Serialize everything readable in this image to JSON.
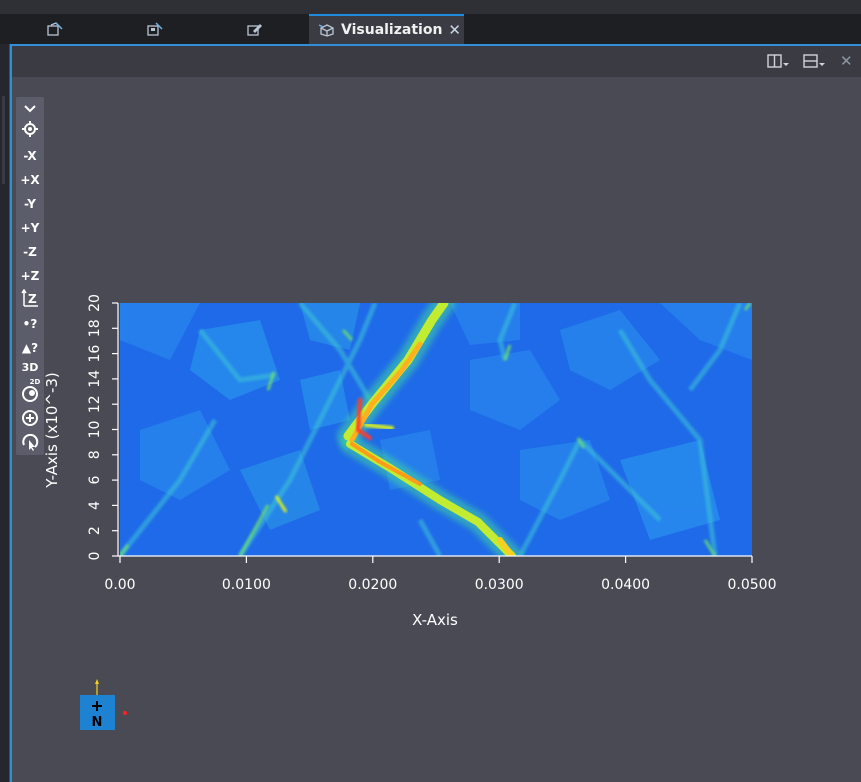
{
  "tabs": [
    {
      "icon": "edit-model-icon"
    },
    {
      "icon": "edit-properties-icon"
    },
    {
      "icon": "edit-pencil-icon"
    },
    {
      "icon": "cube-icon",
      "label": "Visualization",
      "close": "✕",
      "active": true
    }
  ],
  "panel_header": {
    "split_vertical_icon": "split-vertical-icon",
    "split_horizontal_icon": "split-horizontal-icon",
    "close_icon": "✕"
  },
  "toolbar": {
    "items": [
      {
        "name": "collapse-toolbar-button",
        "label": "⌄"
      },
      {
        "name": "reset-camera-button",
        "label": "⊙"
      },
      {
        "name": "view-neg-x-button",
        "label": "-X"
      },
      {
        "name": "view-pos-x-button",
        "label": "+X"
      },
      {
        "name": "view-neg-y-button",
        "label": "-Y"
      },
      {
        "name": "view-pos-y-button",
        "label": "+Y"
      },
      {
        "name": "view-neg-z-button",
        "label": "-Z"
      },
      {
        "name": "view-pos-z-button",
        "label": "+Z"
      },
      {
        "name": "z-scale-button",
        "label": "Z"
      },
      {
        "name": "query-point-button",
        "label": "•?"
      },
      {
        "name": "query-cell-button",
        "label": "▲?"
      },
      {
        "name": "toggle-3d-2d-button",
        "label": "3D",
        "sub": "2D"
      },
      {
        "name": "rotate-button",
        "label": ""
      },
      {
        "name": "zoom-button",
        "label": ""
      },
      {
        "name": "interact-button",
        "label": ""
      }
    ]
  },
  "chart_data": {
    "type": "heatmap",
    "title": "",
    "xlabel": "X-Axis",
    "ylabel": "Y-Axis (x10^-3)",
    "xlim": [
      0,
      0.05
    ],
    "ylim": [
      0,
      20
    ],
    "x_ticks": [
      "0.00",
      "0.0100",
      "0.0200",
      "0.0300",
      "0.0400",
      "0.0500"
    ],
    "y_ticks": [
      "0",
      "2",
      "4",
      "6",
      "8",
      "10",
      "12",
      "14",
      "16",
      "18",
      "20"
    ],
    "colormap": "rainbow (blue → cyan → green → yellow → red)",
    "background_value_color": "#1f6ae8",
    "features": [
      {
        "name": "main-crack-upper",
        "points": [
          [
            0.0185,
            10.0
          ],
          [
            0.0215,
            13.5
          ],
          [
            0.0245,
            17.0
          ],
          [
            0.026,
            20.0
          ]
        ]
      },
      {
        "name": "main-crack-lower",
        "points": [
          [
            0.0185,
            9.0
          ],
          [
            0.022,
            7.5
          ],
          [
            0.026,
            5.0
          ],
          [
            0.0295,
            2.0
          ],
          [
            0.031,
            0.0
          ]
        ]
      },
      {
        "name": "crack-kink",
        "points": [
          [
            0.0195,
            9.2
          ],
          [
            0.0195,
            11.5
          ],
          [
            0.0205,
            11.2
          ]
        ]
      }
    ]
  },
  "orientation_widget": {
    "label": "N",
    "box_color": "#1e82d2",
    "x_axis_color": "#ff2020",
    "y_axis_color": "#f2d21a"
  }
}
